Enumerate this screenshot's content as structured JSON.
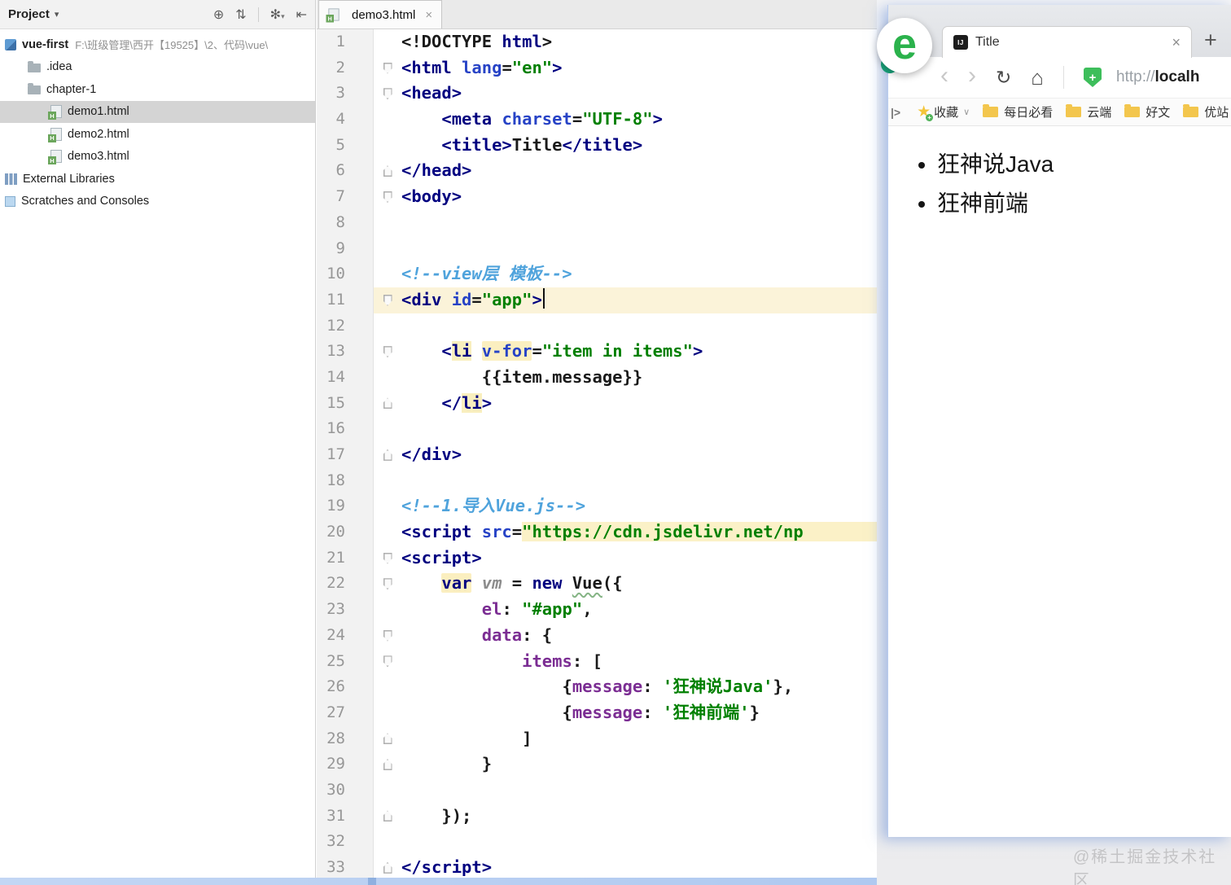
{
  "ide": {
    "project": {
      "title": "Project",
      "caret": "▾",
      "icons": {
        "locate": "⊕",
        "collapse_all": "⇅",
        "settings": "✻",
        "settings_caret": "▾",
        "hide_panel": "⇤"
      },
      "html_badge": "H",
      "items": [
        {
          "label": "vue-first",
          "type": "project",
          "level": 0,
          "suffix": "F:\\班级管理\\西开【19525】\\2、代码\\vue\\"
        },
        {
          "label": ".idea",
          "type": "folder",
          "level": 1
        },
        {
          "label": "chapter-1",
          "type": "folder",
          "level": 1
        },
        {
          "label": "demo1.html",
          "type": "html",
          "level": 2,
          "selected": true
        },
        {
          "label": "demo2.html",
          "type": "html",
          "level": 2
        },
        {
          "label": "demo3.html",
          "type": "html",
          "level": 2
        },
        {
          "label": "External Libraries",
          "type": "lib",
          "level": 0
        },
        {
          "label": "Scratches and Consoles",
          "type": "scratch",
          "level": 0
        }
      ]
    },
    "editor": {
      "tab": "demo3.html",
      "tab_close": "×",
      "lines": [
        {
          "n": 1,
          "tokens": [
            [
              "p",
              "<!DOCTYPE "
            ],
            [
              "t",
              "html"
            ],
            [
              "p",
              ">"
            ]
          ]
        },
        {
          "n": 2,
          "fold": "down",
          "tokens": [
            [
              "t",
              "<html"
            ],
            [
              "p",
              " "
            ],
            [
              "a",
              "lang"
            ],
            [
              "p",
              "="
            ],
            [
              "s",
              "\"en\""
            ],
            [
              "t",
              ">"
            ]
          ]
        },
        {
          "n": 3,
          "fold": "down",
          "tokens": [
            [
              "t",
              "<head>"
            ]
          ]
        },
        {
          "n": 4,
          "tokens": [
            [
              "p",
              "    "
            ],
            [
              "t",
              "<meta"
            ],
            [
              "p",
              " "
            ],
            [
              "a",
              "charset"
            ],
            [
              "p",
              "="
            ],
            [
              "s",
              "\"UTF-8\""
            ],
            [
              "t",
              ">"
            ]
          ]
        },
        {
          "n": 5,
          "tokens": [
            [
              "p",
              "    "
            ],
            [
              "t",
              "<title>"
            ],
            [
              "p",
              "Title"
            ],
            [
              "t",
              "</title>"
            ]
          ]
        },
        {
          "n": 6,
          "fold": "up",
          "tokens": [
            [
              "t",
              "</head>"
            ]
          ]
        },
        {
          "n": 7,
          "fold": "down",
          "tokens": [
            [
              "t",
              "<body>"
            ]
          ]
        },
        {
          "n": 8,
          "tokens": []
        },
        {
          "n": 9,
          "tokens": []
        },
        {
          "n": 10,
          "tokens": [
            [
              "c",
              "<!--view层 模板-->"
            ]
          ]
        },
        {
          "n": 11,
          "fold": "down",
          "hl": true,
          "caret": true,
          "tokens": [
            [
              "t",
              "<div"
            ],
            [
              "p",
              " "
            ],
            [
              "a",
              "id"
            ],
            [
              "p",
              "="
            ],
            [
              "s",
              "\"app\""
            ],
            [
              "t",
              ">"
            ]
          ]
        },
        {
          "n": 12,
          "tokens": []
        },
        {
          "n": 13,
          "fold": "down",
          "tokens": [
            [
              "p",
              "    "
            ],
            [
              "t",
              "<"
            ],
            [
              "t mt",
              "li"
            ],
            [
              "p",
              " "
            ],
            [
              "a hl-y",
              "v-for"
            ],
            [
              "p",
              "="
            ],
            [
              "s",
              "\"item in items\""
            ],
            [
              "t",
              ">"
            ]
          ]
        },
        {
          "n": 14,
          "tokens": [
            [
              "p",
              "        {{item.message}}"
            ]
          ]
        },
        {
          "n": 15,
          "fold": "up",
          "tokens": [
            [
              "p",
              "    "
            ],
            [
              "t",
              "</"
            ],
            [
              "t mt",
              "li"
            ],
            [
              "t",
              ">"
            ]
          ]
        },
        {
          "n": 16,
          "tokens": []
        },
        {
          "n": 17,
          "fold": "up",
          "tokens": [
            [
              "t",
              "</div>"
            ]
          ]
        },
        {
          "n": 18,
          "tokens": []
        },
        {
          "n": 19,
          "tokens": [
            [
              "c",
              "<!--1.导入Vue.js-->"
            ]
          ]
        },
        {
          "n": 20,
          "tokens": [
            [
              "t",
              "<script"
            ],
            [
              "p",
              " "
            ],
            [
              "a",
              "src"
            ],
            [
              "p",
              "="
            ],
            [
              "s inj",
              "\"https://cdn.jsdelivr.net/np"
            ]
          ]
        },
        {
          "n": 21,
          "fold": "down",
          "tokens": [
            [
              "t",
              "<script>"
            ]
          ]
        },
        {
          "n": 22,
          "fold": "down",
          "tokens": [
            [
              "p",
              "    "
            ],
            [
              "k hl-y",
              "var"
            ],
            [
              "p",
              " "
            ],
            [
              "v",
              "vm"
            ],
            [
              "p",
              " = "
            ],
            [
              "k",
              "new"
            ],
            [
              "p",
              " "
            ],
            [
              "p w",
              "Vue"
            ],
            [
              "p",
              "({"
            ]
          ]
        },
        {
          "n": 23,
          "tokens": [
            [
              "p",
              "        "
            ],
            [
              "f",
              "el"
            ],
            [
              "p",
              ": "
            ],
            [
              "s",
              "\"#app\""
            ],
            [
              "p",
              ","
            ]
          ]
        },
        {
          "n": 24,
          "fold": "down",
          "tokens": [
            [
              "p",
              "        "
            ],
            [
              "f",
              "data"
            ],
            [
              "p",
              ": {"
            ]
          ]
        },
        {
          "n": 25,
          "fold": "down",
          "tokens": [
            [
              "p",
              "            "
            ],
            [
              "f",
              "items"
            ],
            [
              "p",
              ": ["
            ]
          ]
        },
        {
          "n": 26,
          "tokens": [
            [
              "p",
              "                {"
            ],
            [
              "f",
              "message"
            ],
            [
              "p",
              ": "
            ],
            [
              "s",
              "'狂神说Java'"
            ],
            [
              "p",
              "},"
            ]
          ]
        },
        {
          "n": 27,
          "tokens": [
            [
              "p",
              "                {"
            ],
            [
              "f",
              "message"
            ],
            [
              "p",
              ": "
            ],
            [
              "s",
              "'狂神前端'"
            ],
            [
              "p",
              "}"
            ]
          ]
        },
        {
          "n": 28,
          "fold": "up",
          "tokens": [
            [
              "p",
              "            ]"
            ]
          ]
        },
        {
          "n": 29,
          "fold": "up",
          "tokens": [
            [
              "p",
              "        }"
            ]
          ]
        },
        {
          "n": 30,
          "tokens": []
        },
        {
          "n": 31,
          "fold": "up",
          "tokens": [
            [
              "p",
              "    });"
            ]
          ]
        },
        {
          "n": 32,
          "tokens": []
        },
        {
          "n": 33,
          "fold": "up",
          "tokens": [
            [
              "t",
              "</script>"
            ]
          ]
        }
      ]
    }
  },
  "browser": {
    "logo_letter": "e",
    "tab": {
      "favicon": "IJ",
      "title": "Title",
      "close": "×",
      "new_tab": "+"
    },
    "nav": {
      "back": "‹",
      "forward": "›",
      "refresh": "↻",
      "home": "⌂",
      "shield_plus": "+",
      "url_scheme": "http://",
      "url_host": "localh"
    },
    "bookmarks": {
      "collapse": "|>",
      "star_badge": "+",
      "star_label": "收藏",
      "caret": "∨",
      "folders": [
        "每日必看",
        "云端",
        "好文",
        "优站"
      ]
    },
    "page_items": [
      "狂神说Java",
      "狂神前端"
    ]
  },
  "watermark": "@稀土掘金技术社区",
  "colors": {
    "accent_green": "#2BB24C",
    "tag_navy": "#000080",
    "string_green": "#008000",
    "field_purple": "#7B2D93",
    "comment_blue": "#4FA3DC",
    "caret_row": "#FBF3D9"
  }
}
